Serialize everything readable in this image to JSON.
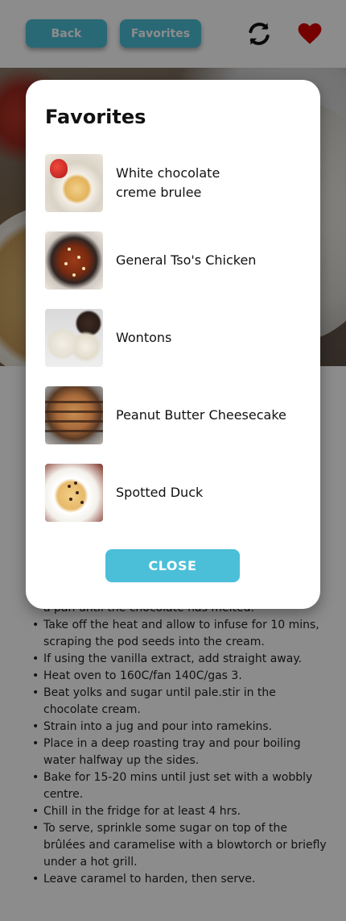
{
  "header": {
    "back_label": "Back",
    "favorites_label": "Favorites",
    "refresh_icon": "refresh-icon",
    "heart_icon": "heart-icon"
  },
  "colors": {
    "accent": "#4bbfd8",
    "heart": "#d40000",
    "overlay": "rgba(0,0,0,0.45)"
  },
  "recipe_steps": [
    "a pan until the chocolate has melted.",
    "Take off the heat and allow to infuse for 10 mins, scraping the pod seeds into the cream.",
    "If using the vanilla extract, add straight away.",
    "Heat oven to 160C/fan 140C/gas 3.",
    "Beat yolks and sugar until pale.stir in the chocolate cream.",
    "Strain into a jug and pour into ramekins.",
    "Place in a deep roasting tray and pour boiling water halfway up the sides.",
    "Bake for 15-20 mins until just set with a wobbly centre.",
    "Chill in the fridge for at least 4 hrs.",
    "To serve, sprinkle some sugar on top of the brûlées and caramelise with a blowtorch or briefly under a hot grill.",
    "Leave caramel to harden, then serve."
  ],
  "modal": {
    "title": "Favorites",
    "items": [
      {
        "label_line1": "White chocolate",
        "label_line2": "creme brulee",
        "image": "creme-brulee-image"
      },
      {
        "label_line1": "General Tso's Chicken",
        "label_line2": "",
        "image": "general-tso-chicken-image"
      },
      {
        "label_line1": "Wontons",
        "label_line2": "",
        "image": "wontons-image"
      },
      {
        "label_line1": "Peanut Butter Cheesecake",
        "label_line2": "",
        "image": "peanut-butter-cheesecake-image"
      },
      {
        "label_line1": "Spotted Duck",
        "label_line2": "",
        "image": "spotted-duck-image"
      }
    ],
    "close_label": "CLOSE"
  }
}
